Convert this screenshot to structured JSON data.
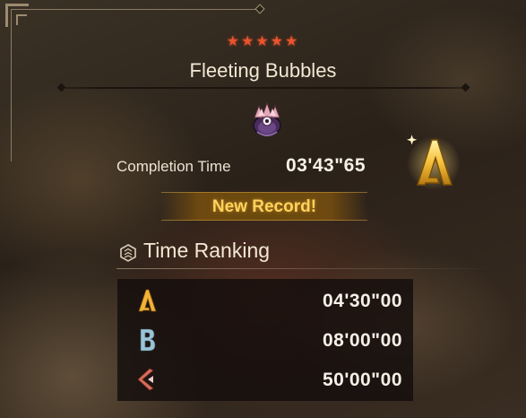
{
  "quest": {
    "star_rating": "★★★★★",
    "title": "Fleeting Bubbles"
  },
  "monster_icon": "monster-portrait-icon",
  "result": {
    "completion_label": "Completion Time",
    "completion_time": "03'43\"65",
    "rank": "A",
    "new_record": "New Record!"
  },
  "ranking": {
    "label": "Time Ranking",
    "rows": [
      {
        "rank": "A",
        "time": "04'30\"00",
        "color": "#f2b23a"
      },
      {
        "rank": "B",
        "time": "08'00\"00",
        "color": "#9cc2d6"
      },
      {
        "rank": "C",
        "time": "50'00\"00",
        "color": "#d96b5a"
      }
    ]
  },
  "colors": {
    "star": "#e9532e",
    "new_record_text": "#ffd35a",
    "gold": "#f2b23a"
  }
}
